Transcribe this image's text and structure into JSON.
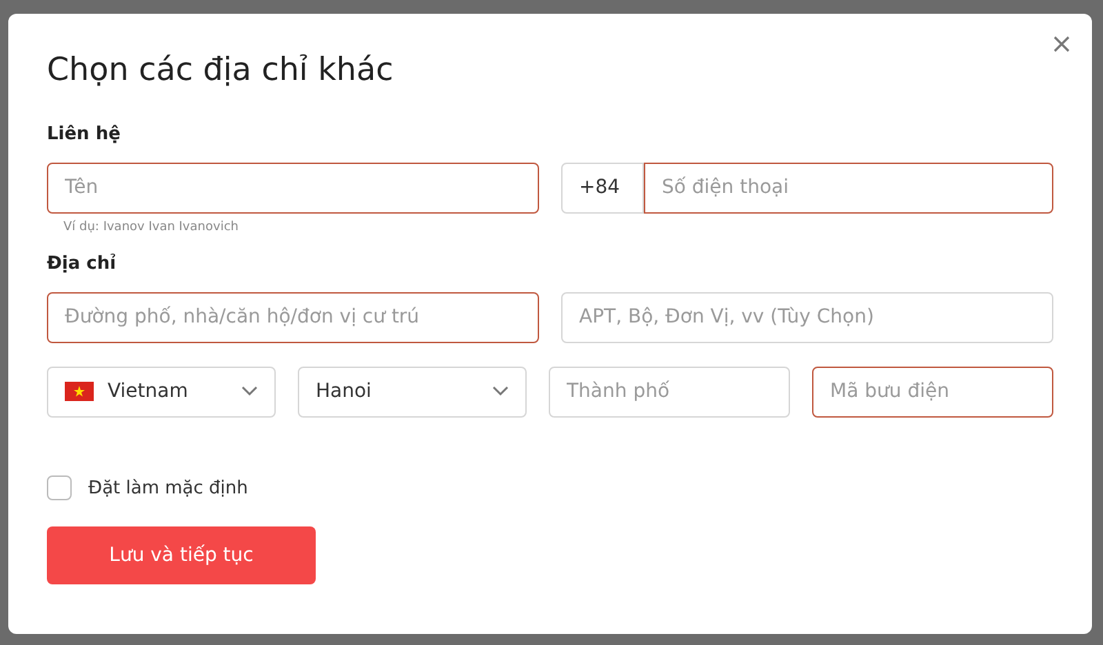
{
  "dialog": {
    "title": "Chọn các địa chỉ khác"
  },
  "contact": {
    "heading": "Liên hệ",
    "name_field": {
      "placeholder": "Tên",
      "invalid": true,
      "hint": "Ví dụ: Ivanov Ivan Ivanovich"
    },
    "phone_code": "+84",
    "phone_field": {
      "placeholder": "Số điện thoại",
      "invalid": true
    }
  },
  "address": {
    "heading": "Địa chỉ",
    "fields": [
      {
        "placeholder": "Đường phố, nhà/căn hộ/đơn vị cư trú",
        "invalid": true
      },
      {
        "placeholder": "APT, Bộ, Đơn Vị, vv (Tùy Chọn)",
        "invalid": false
      }
    ],
    "row": [
      {
        "kind": "country",
        "value": "Vietnam"
      },
      {
        "kind": "select",
        "value": "Hanoi"
      },
      {
        "kind": "input",
        "placeholder": "Thành phố",
        "invalid": false
      },
      {
        "kind": "input",
        "placeholder": "Mã bưu điện",
        "invalid": true
      }
    ]
  },
  "default_checkbox": {
    "label": "Đặt làm mặc định",
    "checked": false
  },
  "submit": "Lưu và tiếp tục"
}
